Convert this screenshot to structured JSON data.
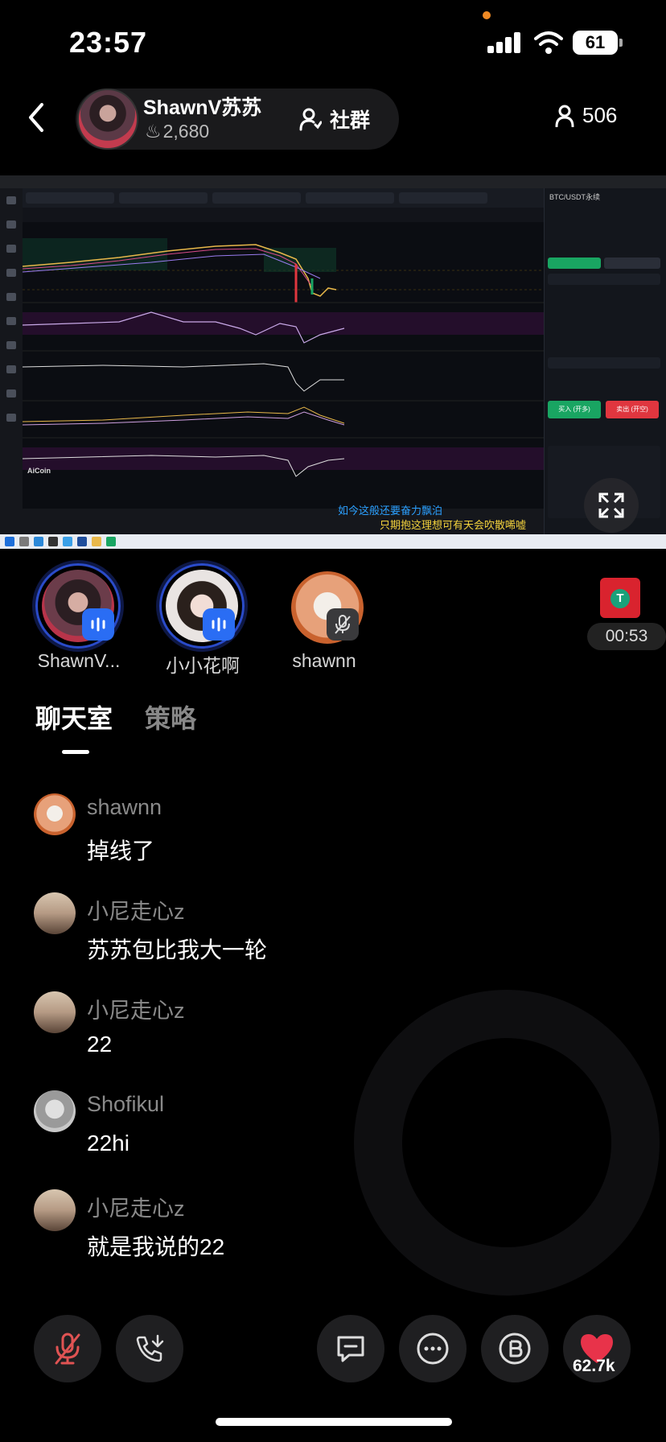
{
  "status_bar": {
    "time": "23:57",
    "battery": "61"
  },
  "header": {
    "host_name": "ShawnV苏苏",
    "host_likes": "2,680",
    "community_label": "社群",
    "listener_count": "506"
  },
  "screen_share": {
    "subtitle_line1": "如今这般还要奋力飘泊",
    "subtitle_line2": "只期抱这理想可有天会吹散唏嘘",
    "watermark_text": "AiCoin",
    "panel_title": "BTC/USDT永续",
    "buy_label": "买入 (开多)",
    "sell_label": "卖出 (开空)"
  },
  "speakers": [
    {
      "name": "ShawnV...",
      "state": "speaking"
    },
    {
      "name": "小小花啊",
      "state": "speaking"
    },
    {
      "name": "shawnn",
      "state": "muted"
    }
  ],
  "timer": "00:53",
  "tabs": {
    "chat": "聊天室",
    "strategy": "策略"
  },
  "messages": [
    {
      "name": "shawnn",
      "text": "掉线了"
    },
    {
      "name": "小尼走心z",
      "text": "苏苏包比我大一轮"
    },
    {
      "name": "小尼走心z",
      "text": "22"
    },
    {
      "name": "Shofikul",
      "text": "22hi"
    },
    {
      "name": "小尼走心z",
      "text": "就是我说的22"
    }
  ],
  "controls": {
    "like_count": "62.7k"
  },
  "colors": {
    "accent_blue": "#2a6df4",
    "like_red": "#e8334a",
    "mic_off_red": "#e05353"
  }
}
